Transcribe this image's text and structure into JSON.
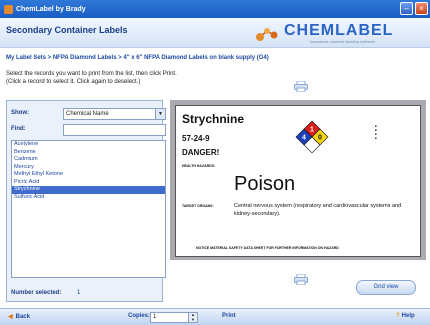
{
  "window": {
    "title": "ChemLabel by Brady"
  },
  "header": {
    "heading": "Secondary Container Labels",
    "logo_text": "CHEMLABEL",
    "logo_tagline": "hazardous material labeling software"
  },
  "breadcrumb": "My Label Sets > NFPA Diamond Labels > 4\" x 6\" NFPA Diamond Labels on blank supply (G4)",
  "instructions": {
    "line1": "Select the records you want to print from the list, then click Print.",
    "line2": "(Click a record to select it.  Click again to deselect.)"
  },
  "filters": {
    "show_label": "Show:",
    "show_value": "Chemical Name",
    "find_label": "Find:",
    "find_value": ""
  },
  "chemicals": [
    {
      "name": "Acetylene",
      "selected": false
    },
    {
      "name": "Benzene",
      "selected": false
    },
    {
      "name": "Cadmium",
      "selected": false
    },
    {
      "name": "Mercury",
      "selected": false
    },
    {
      "name": "Methyl Ethyl Ketone",
      "selected": false
    },
    {
      "name": "Picric Acid",
      "selected": false
    },
    {
      "name": "Strychnine",
      "selected": true
    },
    {
      "name": "Sulfuric Acid",
      "selected": false
    }
  ],
  "number_selected": {
    "label": "Number selected:",
    "value": "1"
  },
  "label_preview": {
    "name": "Strychnine",
    "cas": "57-24-9",
    "signal": "DANGER!",
    "health_hazard_label": "HEALTH HAZARDS:",
    "target_organs_label": "TARGET ORGANS:",
    "hazard": "Poison",
    "description": "Central nervous system (respiratory and cardiovascular systems and kidney-secondary).",
    "footer": "NOTICE MATERIAL SAFETY DATA SHEET FOR FURTHER INFORMATION ON HAZARD",
    "nfpa": {
      "health": "4",
      "flammability": "1",
      "reactivity": "0",
      "special": ""
    },
    "nfpa_colors": {
      "health": "#1a3fb8",
      "flammability": "#d8201a",
      "reactivity": "#f3d21a",
      "special": "#ffffff"
    }
  },
  "buttons": {
    "grid_view": "Grid view",
    "back": "Back",
    "copies_label": "Copies:",
    "copies_value": "1",
    "print": "Print",
    "help": "Help"
  },
  "colors": {
    "accent": "#2a64c6",
    "selection": "#3e6bcc",
    "title_bar": "#1a5cc4"
  }
}
